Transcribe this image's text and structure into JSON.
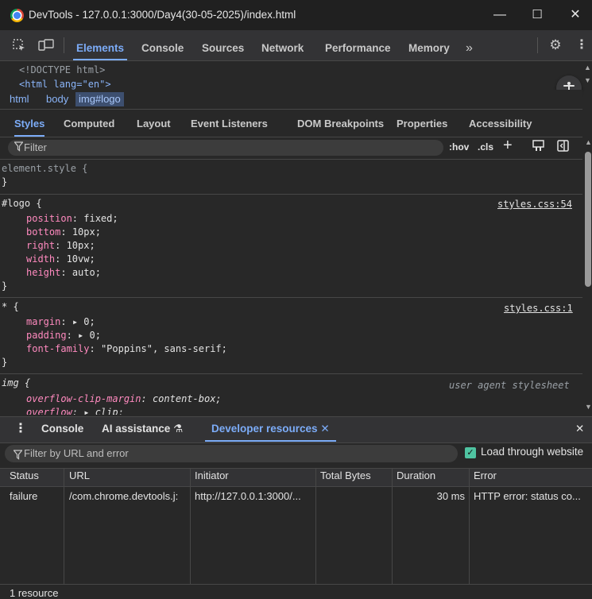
{
  "window": {
    "title": "DevTools - 127.0.0.1:3000/Day4(30-05-2025)/index.html",
    "minimize": "—",
    "maximize": "☐",
    "close": "✕"
  },
  "main_tabs": [
    "Elements",
    "Console",
    "Sources",
    "Network",
    "Performance",
    "Memory",
    "»"
  ],
  "dom_tree": {
    "line1": "<!DOCTYPE html>",
    "line2": "<html lang=\"en\">"
  },
  "breadcrumb": [
    "html",
    "body",
    "img#logo"
  ],
  "style_tabs": [
    "Styles",
    "Computed",
    "Layout",
    "Event Listeners",
    "DOM Breakpoints",
    "Properties",
    "Accessibility"
  ],
  "styles_filter": {
    "placeholder": "Filter",
    "hov": ":hov",
    "cls": ".cls"
  },
  "rules": {
    "element_style": {
      "selector": "element.style {",
      "close": "}"
    },
    "logo": {
      "selector": "#logo {",
      "source": "styles.css:54",
      "props": [
        {
          "name": "position",
          "value": "fixed;"
        },
        {
          "name": "bottom",
          "value": "10px;"
        },
        {
          "name": "right",
          "value": "10px;"
        },
        {
          "name": "width",
          "value": "10vw;"
        },
        {
          "name": "height",
          "value": "auto;"
        }
      ],
      "close": "}"
    },
    "universal": {
      "selector": "* {",
      "source": "styles.css:1",
      "props": [
        {
          "name": "margin",
          "value": "▸ 0;"
        },
        {
          "name": "padding",
          "value": "▸ 0;"
        },
        {
          "name": "font-family",
          "value": "\"Poppins\", sans-serif;"
        }
      ],
      "close": "}"
    },
    "img": {
      "selector": "img {",
      "source": "user agent stylesheet",
      "props": [
        {
          "name": "overflow-clip-margin",
          "value": "content-box;"
        },
        {
          "name": "overflow",
          "value": "▸ clip;"
        }
      ]
    }
  },
  "drawer_tabs": [
    "⋮",
    "Console",
    "AI assistance",
    "Developer resources"
  ],
  "drawer_close": "✕",
  "devres": {
    "filter_placeholder": "Filter by URL and error",
    "load_label": "Load through website",
    "columns": [
      "Status",
      "URL",
      "Initiator",
      "Total Bytes",
      "Duration",
      "Error"
    ],
    "rows": [
      {
        "status": "failure",
        "url": "/com.chrome.devtools.j:",
        "initiator": "http://127.0.0.1:3000/...",
        "total_bytes": "",
        "duration": "30 ms",
        "error": "HTTP error: status co..."
      }
    ],
    "footer": "1 resource"
  }
}
